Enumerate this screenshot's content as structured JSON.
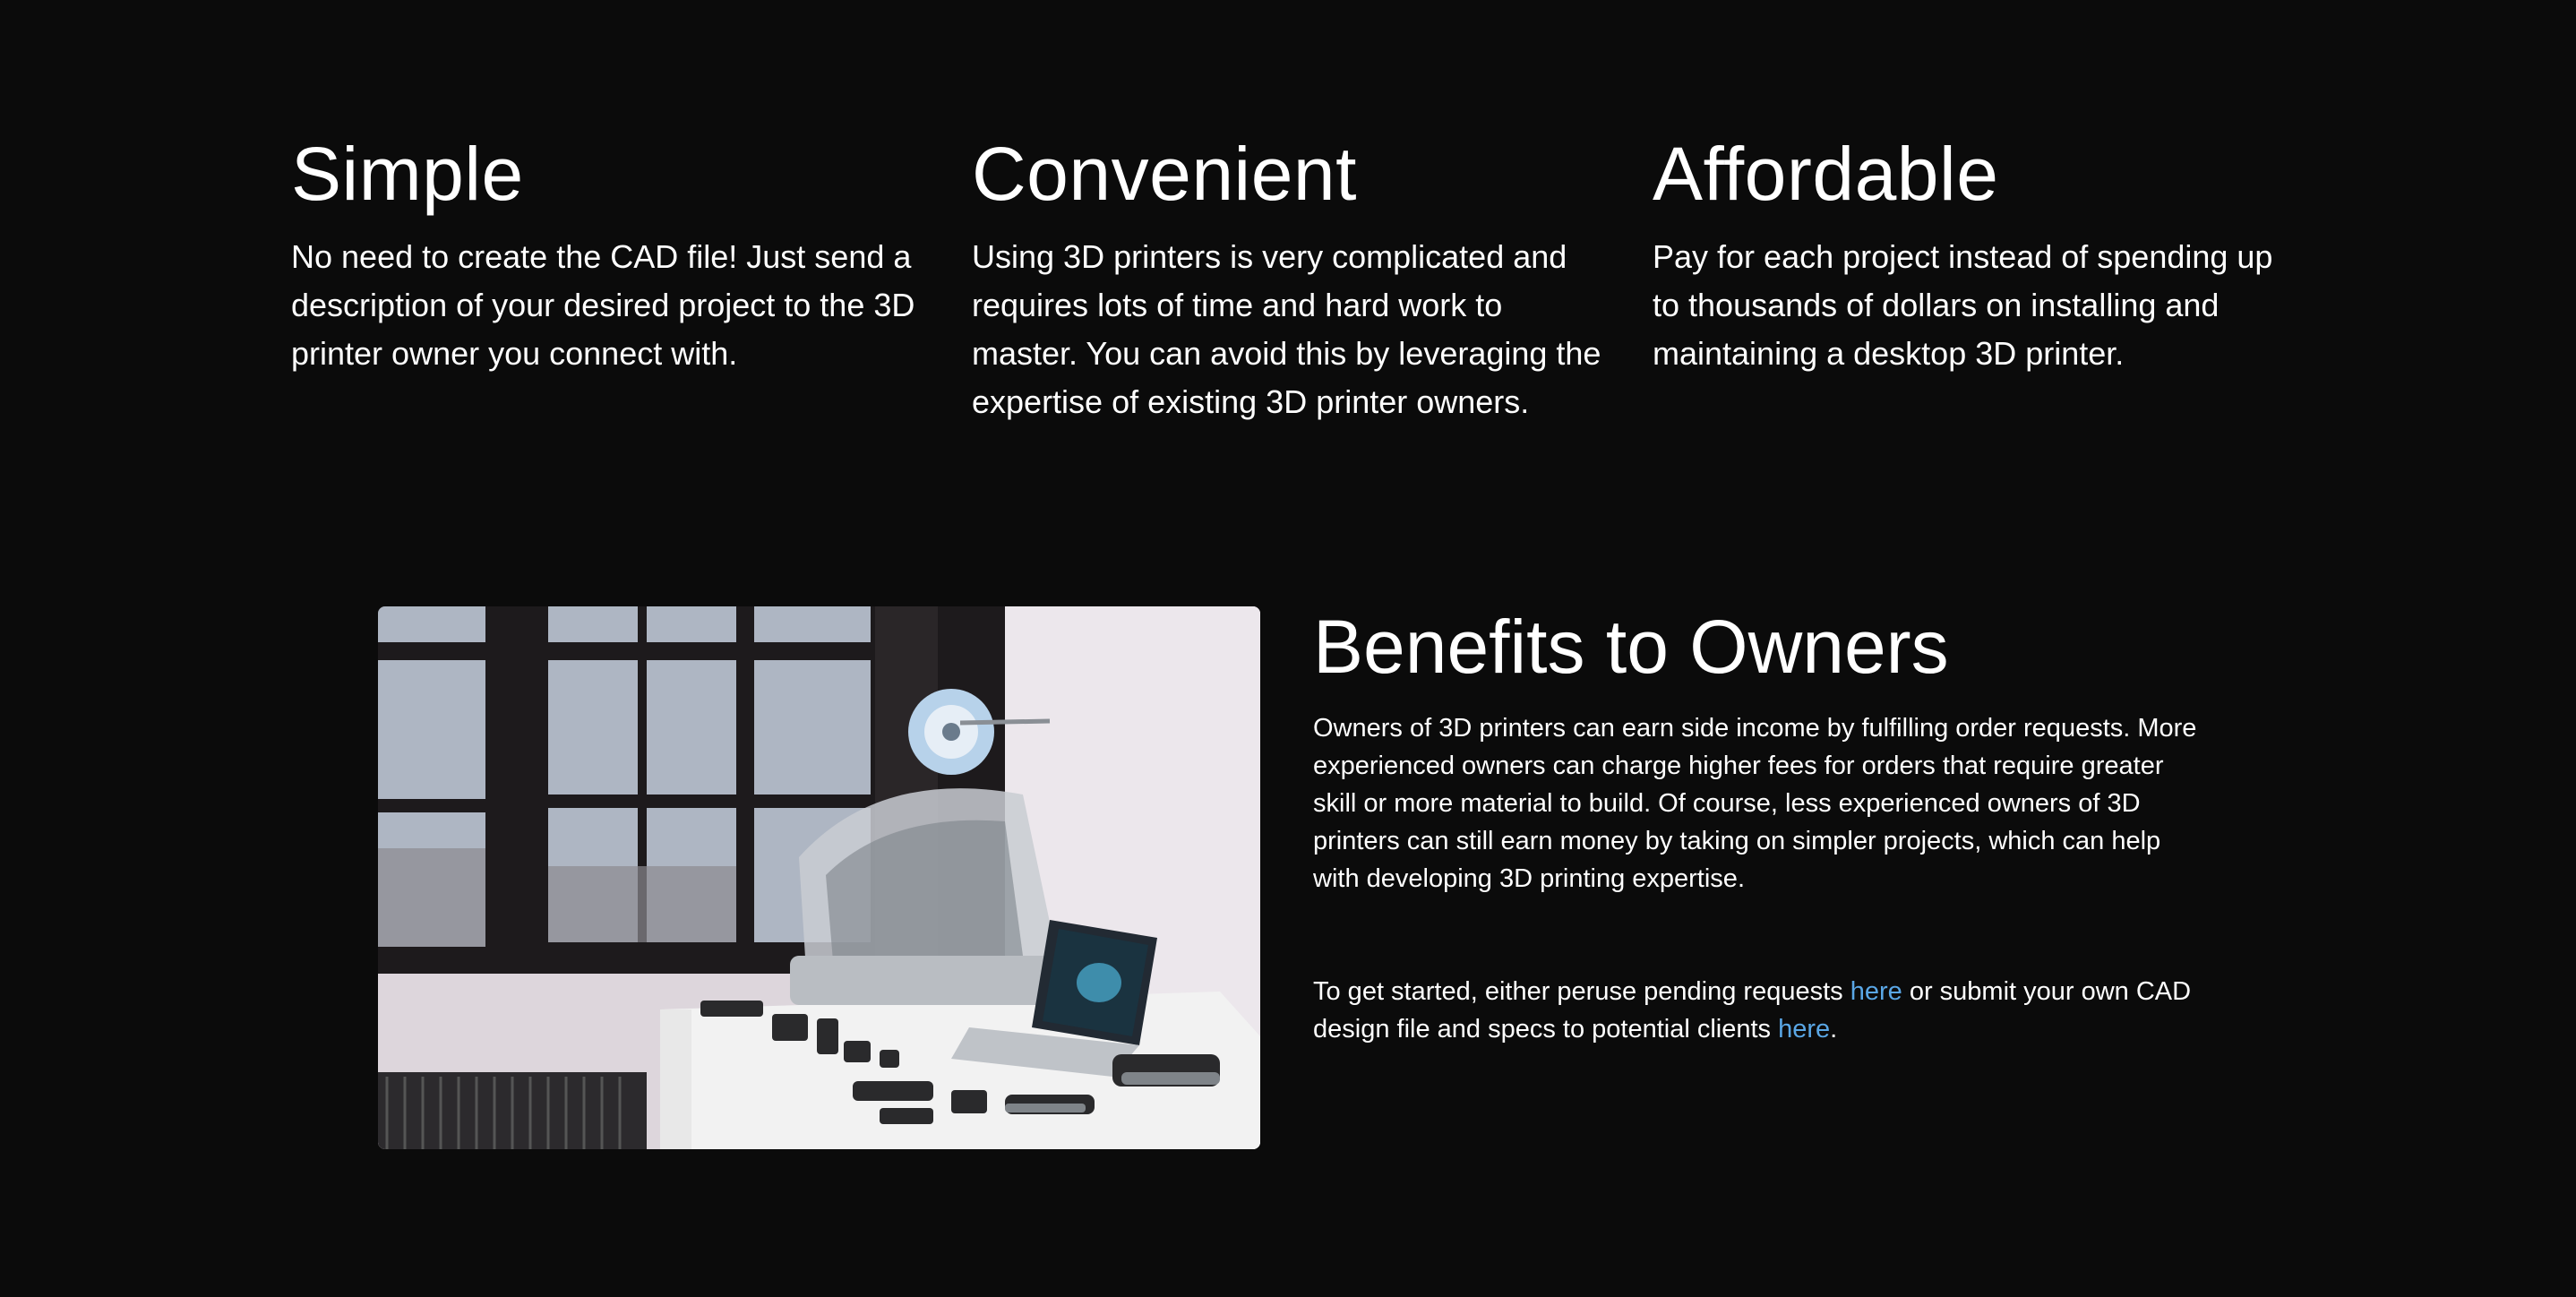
{
  "features": [
    {
      "title": "Simple",
      "body": "No need to create the CAD file! Just send a description of your desired project to the 3D printer owner you connect with."
    },
    {
      "title": "Convenient",
      "body": "Using 3D printers is very complicated and requires lots of time and hard work to master. You can avoid this by leveraging the expertise of existing 3D printer owners."
    },
    {
      "title": "Affordable",
      "body": "Pay for each project instead of spending up to thousands of dollars on installing and maintaining a desktop 3D printer."
    }
  ],
  "benefits": {
    "title": "Benefits to Owners",
    "body": "Owners of 3D printers can earn side income by fulfilling order requests. More experienced owners can charge higher fees for orders that require greater skill or more material to build. Of course, less experienced owners of 3D printers can still earn money by taking on simpler projects, which can help with developing 3D printing expertise.",
    "cta_prefix": "To get started, either peruse pending requests ",
    "cta_link1": "here",
    "cta_middle": " or submit your own CAD design file and specs to potential clients ",
    "cta_link2": "here",
    "cta_suffix": "."
  },
  "colors": {
    "background": "#0b0b0b",
    "text": "#ffffff",
    "link": "#5aa7e6"
  }
}
